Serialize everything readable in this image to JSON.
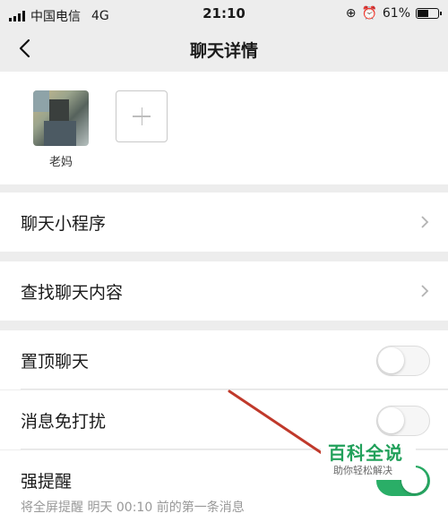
{
  "status_bar": {
    "carrier": "中国电信",
    "network": "4G",
    "time": "21:10",
    "battery_percent": "61%",
    "battery_level": 0.61
  },
  "nav": {
    "title": "聊天详情",
    "back_icon": "chevron-left-icon"
  },
  "members": [
    {
      "name": "老妈"
    }
  ],
  "add_member_icon": "plus-icon",
  "cells": {
    "mini_program": {
      "label": "聊天小程序"
    },
    "search_chat": {
      "label": "查找聊天内容"
    },
    "pin_chat": {
      "label": "置顶聊天",
      "enabled": false
    },
    "mute": {
      "label": "消息免打扰",
      "enabled": false
    },
    "strong_reminder": {
      "label": "强提醒",
      "description": "将全屏提醒 明天 00:10 前的第一条消息",
      "enabled": true
    }
  },
  "watermark": {
    "title": "百科全说",
    "subtitle": "助你轻松解决"
  },
  "colors": {
    "accent_green": "#2aae67",
    "annotation_arrow": "#c0392b",
    "background": "#ededed"
  }
}
